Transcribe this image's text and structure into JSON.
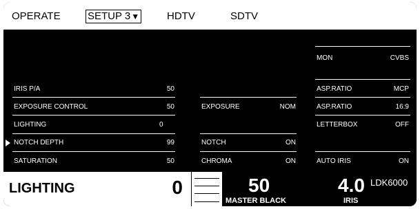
{
  "tabs": [
    {
      "label": "OPERATE",
      "active": false
    },
    {
      "label": "SETUP 3",
      "active": true,
      "indicator": "▼"
    },
    {
      "label": "HDTV",
      "active": false
    },
    {
      "label": "SDTV",
      "active": false
    }
  ],
  "left_menu": [
    {
      "label": "IRIS P/A",
      "value": "50",
      "selected": false
    },
    {
      "label": "EXPOSURE CONTROL",
      "value": "50",
      "selected": false
    },
    {
      "label": "LIGHTING",
      "value": "0",
      "selected": false
    },
    {
      "label": "NOTCH DEPTH",
      "value": "99",
      "selected": true
    },
    {
      "label": "SATURATION",
      "value": "50",
      "selected": false
    }
  ],
  "middle_params": [
    {
      "label": "EXPOSURE",
      "value": "NOM"
    },
    {
      "label": "NOTCH",
      "value": "ON"
    },
    {
      "label": "CHROMA",
      "value": "ON"
    }
  ],
  "right_params": [
    {
      "label": "MON",
      "value": "CVBS"
    },
    {
      "label": "ASP.RATIO",
      "value": "MCP"
    },
    {
      "label": "ASP.RATIO",
      "value": "16:9"
    },
    {
      "label": "LETTERBOX",
      "value": "OFF"
    },
    {
      "label": "AUTO IRIS",
      "value": "ON"
    }
  ],
  "bottom": {
    "param_name": "LIGHTING",
    "param_value": "0",
    "master_black_value": "50",
    "master_black_label": "MASTER BLACK",
    "iris_value": "4.0",
    "iris_label": "IRIS",
    "model": "LDK6000"
  },
  "colors": {
    "background": "#000000",
    "foreground": "#ffffff",
    "frame": "#111111"
  },
  "icons": {
    "selection_cursor": "triangle-right-icon",
    "dropdown_indicator": "triangle-down-icon"
  }
}
